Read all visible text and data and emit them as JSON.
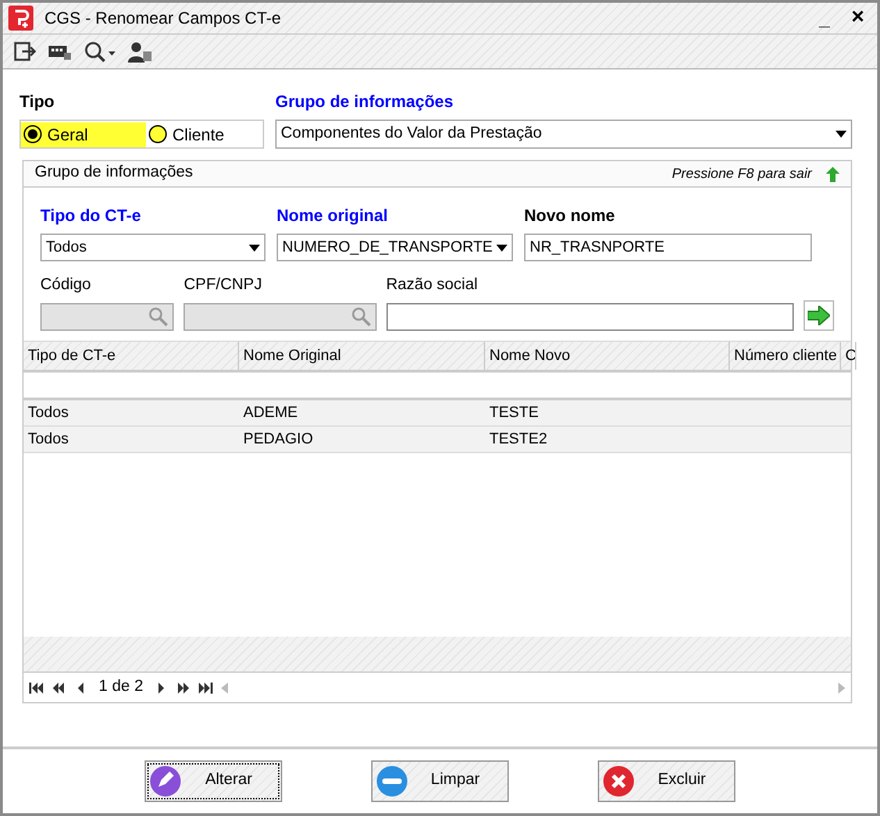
{
  "window": {
    "title": "CGS - Renomear Campos CT-e",
    "controls": [
      "_",
      "×"
    ]
  },
  "tipo": {
    "label": "Tipo",
    "options": [
      {
        "label": "Geral",
        "selected": true
      },
      {
        "label": "Cliente",
        "selected": false
      }
    ]
  },
  "grupo": {
    "label": "Grupo de informações",
    "value": "Componentes do Valor da Prestação"
  },
  "panel": {
    "title": "Grupo de informações",
    "hint": "Pressione F8 para sair",
    "tipo_cte": {
      "label": "Tipo do CT-e",
      "value": "Todos"
    },
    "nome_original": {
      "label": "Nome original",
      "value": "NUMERO_DE_TRANSPORTE"
    },
    "novo_nome": {
      "label": "Novo nome",
      "value": "NR_TRASNPORTE"
    },
    "codigo": {
      "label": "Código"
    },
    "cpf": {
      "label": "CPF/CNPJ"
    },
    "razao": {
      "label": "Razão social"
    }
  },
  "table": {
    "columns": [
      "Tipo de CT-e",
      "Nome Original",
      "Nome Novo",
      "Número cliente",
      "C"
    ],
    "rows": [
      [
        "Todos",
        "ADEME",
        "TESTE"
      ],
      [
        "Todos",
        "PEDAGIO",
        "TESTE2"
      ]
    ]
  },
  "pager": {
    "text": "1 de 2"
  },
  "buttons": [
    {
      "label": "Alterar",
      "kind": "edit"
    },
    {
      "label": "Limpar",
      "kind": "clear"
    },
    {
      "label": "Excluir",
      "kind": "delete"
    }
  ]
}
